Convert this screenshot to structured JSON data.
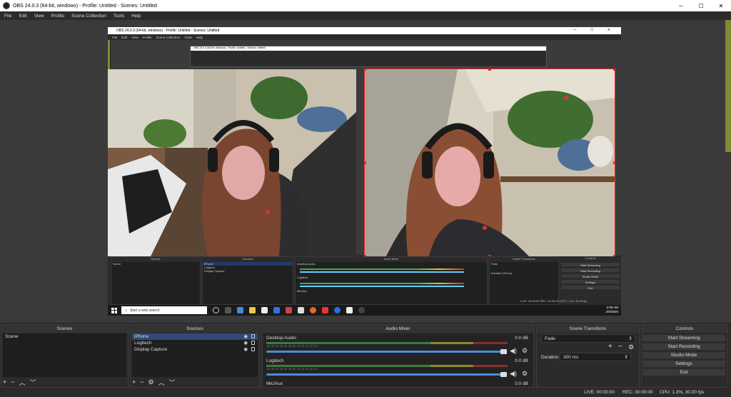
{
  "window": {
    "title": "OBS 24.0.3 (64-bit, windows) - Profile: Untitled - Scenes: Untitled",
    "minimize": "─",
    "maximize": "☐",
    "close": "✕"
  },
  "menu": [
    "File",
    "Edit",
    "View",
    "Profile",
    "Scene Collection",
    "Tools",
    "Help"
  ],
  "preview": {
    "inner_title": "OBS 24.0.3 (64-bit, windows) - Profile: Untitled - Scenes: Untitled",
    "inner_menu": [
      "File",
      "Edit",
      "View",
      "Profile",
      "Scene Collection",
      "Tools",
      "Help"
    ],
    "inner_docks": {
      "scenes": "Scenes",
      "scene_item": "Scene",
      "sources": "Sources",
      "source_items": [
        "iPhone",
        "Logitech",
        "Display Capture"
      ],
      "mixer": "Audio Mixer",
      "desktop_audio": "Desktop Audio",
      "logitech": "Logitech",
      "mic": "Mic/Aux",
      "transitions": "Scene Transitions",
      "fade": "Fade",
      "duration_label": "Duration",
      "duration_value": "300 ms",
      "controls": "Controls",
      "buttons": [
        "Start Streaming",
        "Start Recording",
        "Studio Mode",
        "Settings",
        "Exit"
      ],
      "status": "LIVE: 00:00:00     REC: 00:00:00     CPU: 1.3%, 30.00 fps"
    },
    "taskbar": {
      "search_placeholder": "Start a web search",
      "time": "2:08 AM",
      "date": "2/9/2020"
    }
  },
  "scenes": {
    "title": "Scenes",
    "items": [
      "Scene"
    ]
  },
  "sources": {
    "title": "Sources",
    "items": [
      {
        "name": "iPhone",
        "selected": true
      },
      {
        "name": "Logitech",
        "selected": false
      },
      {
        "name": "Display Capture",
        "selected": false
      }
    ]
  },
  "mixer": {
    "title": "Audio Mixer",
    "channels": [
      {
        "name": "Desktop Audio",
        "db": "0.0 dB",
        "level": 0.0
      },
      {
        "name": "Logitech",
        "db": "0.0 dB",
        "level": 0.0
      },
      {
        "name": "Mic/Aux",
        "db": "0.0 dB",
        "level": 0.0
      }
    ],
    "ticks": "-60  -55  -50  -45  -40  -35  -30  -25  -20  -15  -10  -5  0"
  },
  "transitions": {
    "title": "Scene Transitions",
    "selected": "Fade",
    "duration_label": "Duration",
    "duration_value": "300 ms"
  },
  "controls": {
    "title": "Controls",
    "buttons": [
      "Start Streaming",
      "Start Recording",
      "Studio Mode",
      "Settings",
      "Exit"
    ]
  },
  "status": {
    "live": "LIVE: 00:00:00",
    "rec": "REC: 00:00:00",
    "cpu": "CPU: 1.3%, 30.00 fps"
  },
  "icons": {
    "add": "+",
    "remove": "−",
    "up": "︿",
    "down": "﹀",
    "gear": "⚙",
    "eye": "👁",
    "volume": "🔊"
  },
  "colors": {
    "bg": "#2b2b2b",
    "selection": "#2f4a7a",
    "volume_slider": "#4f8cd6",
    "source_outline": "#ff2020",
    "accent_olive": "#808a30"
  }
}
